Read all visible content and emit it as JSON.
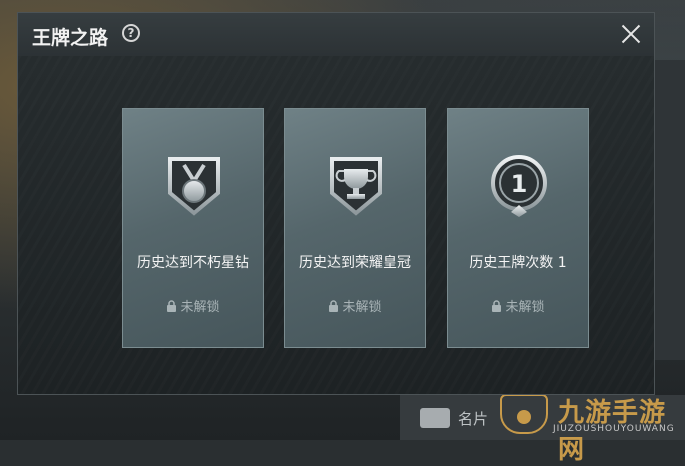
{
  "dialog": {
    "title": "王牌之路",
    "help_symbol": "?"
  },
  "cards": [
    {
      "title": "历史达到不朽星钻",
      "status": "未解锁",
      "badge_icon": "medal-icon"
    },
    {
      "title": "历史达到荣耀皇冠",
      "status": "未解锁",
      "badge_icon": "trophy-icon"
    },
    {
      "title": "历史王牌次数 1",
      "status": "未解锁",
      "badge_icon": "number-one-badge-icon",
      "badge_number": "1"
    }
  ],
  "background": {
    "card_label": "名片",
    "watermark_main": "九游手游网",
    "watermark_sub": "JIUZOUSHOUYOUWANG"
  },
  "colors": {
    "card_bg": "#5d6f74",
    "card_text": "#f4f4f4",
    "locked_text": "#a9b4b7",
    "watermark": "#c79a4a"
  }
}
